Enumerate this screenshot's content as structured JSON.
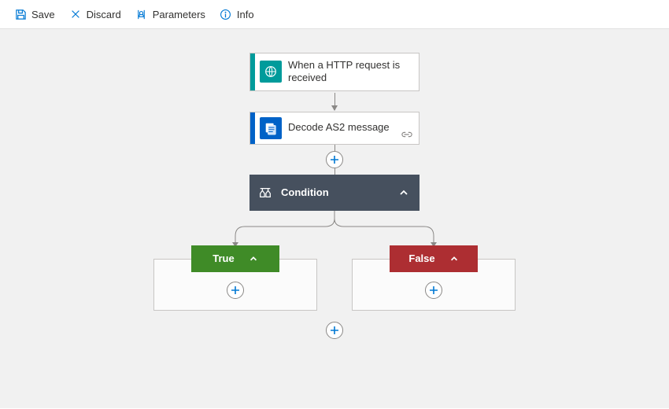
{
  "toolbar": {
    "save": "Save",
    "discard": "Discard",
    "parameters": "Parameters",
    "info": "Info"
  },
  "trigger": {
    "title": "When a HTTP request is received"
  },
  "action_decode": {
    "title": "Decode AS2 message"
  },
  "condition": {
    "title": "Condition"
  },
  "branches": {
    "true_label": "True",
    "false_label": "False"
  },
  "colors": {
    "http": "#009b9b",
    "as2": "#0062c7",
    "condition": "#46505e",
    "true": "#3f8b27",
    "false": "#ad2e32",
    "canvas": "#f1f1f1"
  }
}
